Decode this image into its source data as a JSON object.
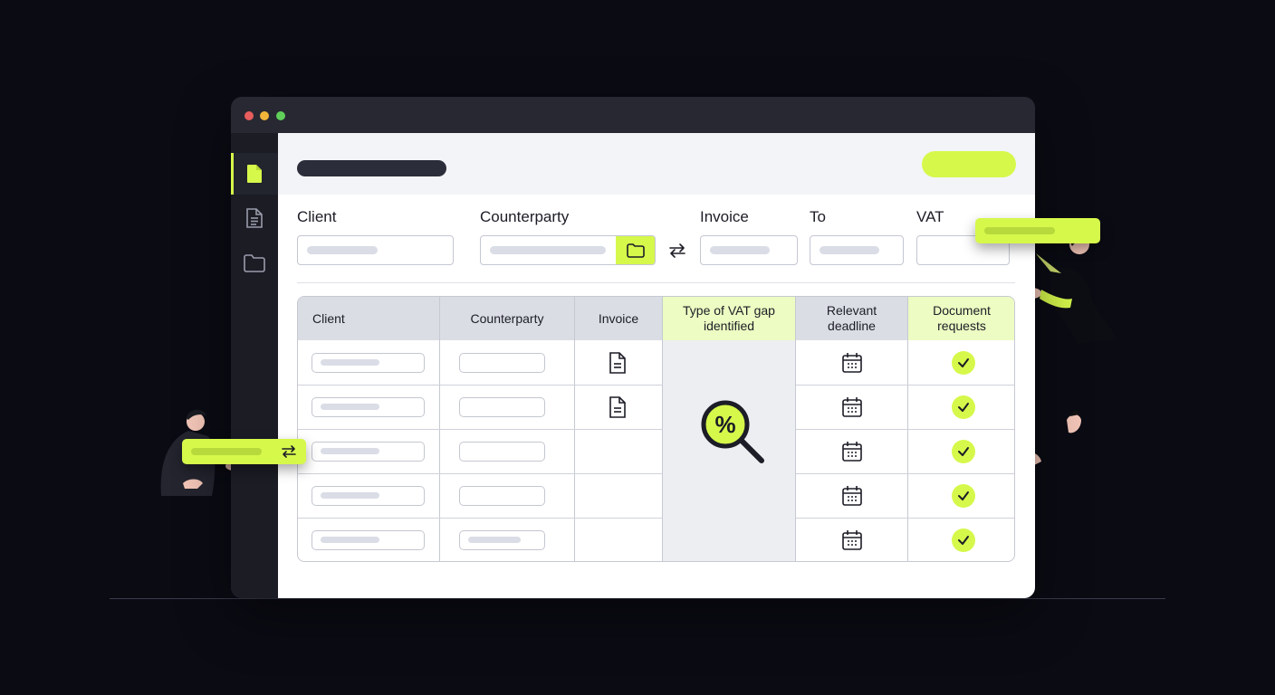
{
  "colors": {
    "background": "#0b0b14",
    "accent": "#d6f84b",
    "window_chrome": "#272832",
    "sidebar": "#1b1c24",
    "traffic_red": "#e85d5d",
    "traffic_yellow": "#f2b53a",
    "traffic_green": "#5fcf5a"
  },
  "sidebar": {
    "items": [
      {
        "icon": "document-filled-icon",
        "active": true
      },
      {
        "icon": "document-lines-icon",
        "active": false
      },
      {
        "icon": "folder-icon",
        "active": false
      }
    ]
  },
  "filters": {
    "labels": {
      "client": "Client",
      "counterparty": "Counterparty",
      "invoice": "Invoice",
      "to": "To",
      "vat": "VAT"
    },
    "swap_icon": "swap-arrows-icon",
    "folder_button_icon": "folder-icon"
  },
  "table": {
    "headers": {
      "client": "Client",
      "counterparty": "Counterparty",
      "invoice": "Invoice",
      "vat_gap": "Type of VAT gap identified",
      "deadline": "Relevant deadline",
      "documents": "Document requests"
    },
    "rows": [
      {
        "invoice_icon": "document-icon",
        "deadline_icon": "calendar-icon",
        "document_request": "check-icon"
      },
      {
        "invoice_icon": "document-icon",
        "deadline_icon": "calendar-icon",
        "document_request": "check-icon"
      },
      {
        "invoice_icon": null,
        "deadline_icon": "calendar-icon",
        "document_request": "check-icon"
      },
      {
        "invoice_icon": null,
        "deadline_icon": "calendar-icon",
        "document_request": "check-icon"
      },
      {
        "invoice_icon": null,
        "deadline_icon": "calendar-icon",
        "document_request": "check-icon"
      }
    ],
    "vat_gap_icon": "percent-magnifier-icon"
  },
  "floating_tags": {
    "left_icon": "swap-arrows-icon"
  }
}
